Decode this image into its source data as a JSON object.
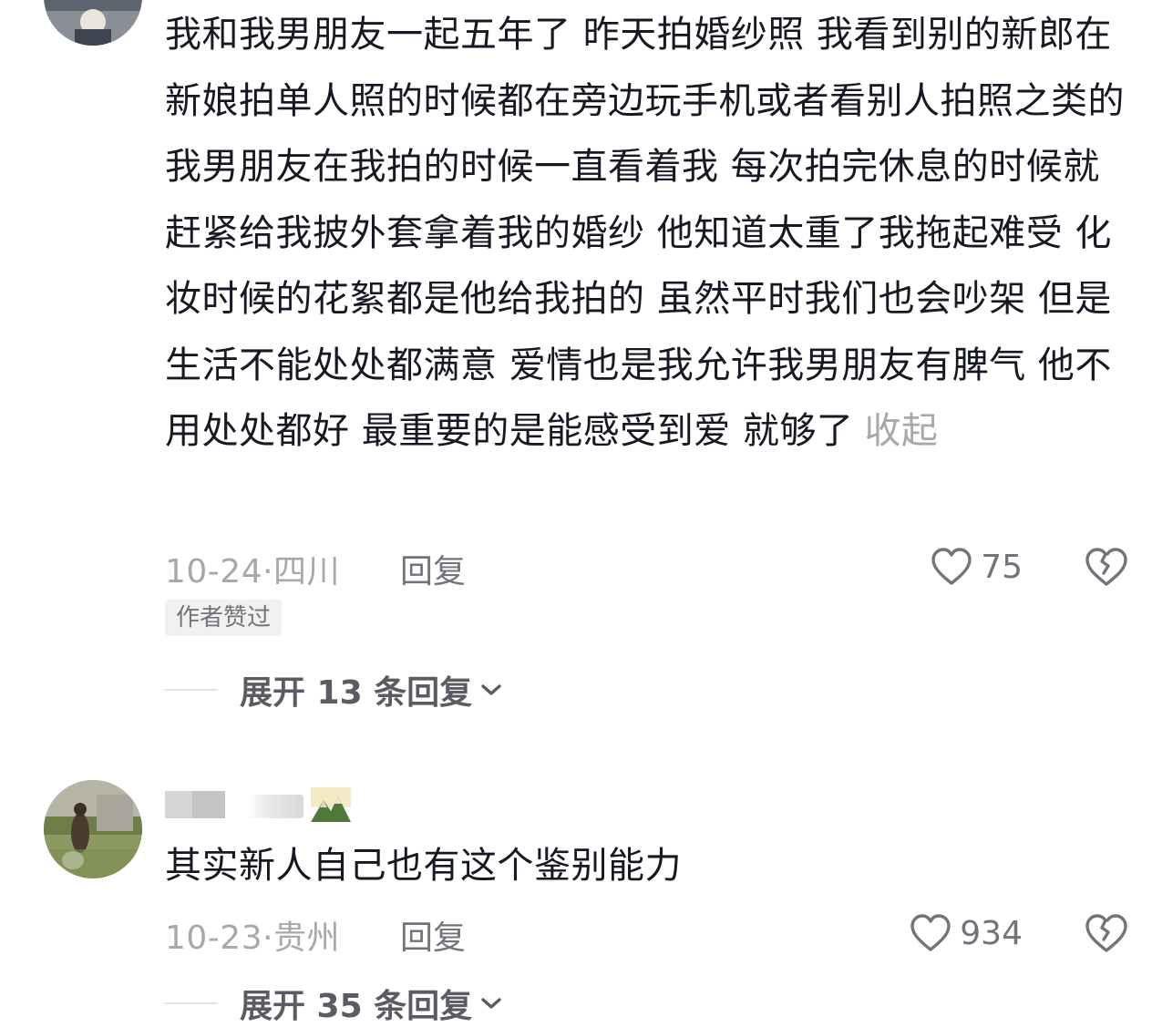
{
  "comments": [
    {
      "text": "我和我男朋友一起五年了 昨天拍婚纱照 我看到别的新郎在新娘拍单人照的时候都在旁边玩手机或者看别人拍照之类的 我男朋友在我拍的时候一直看着我 每次拍完休息的时候就赶紧给我披外套拿着我的婚纱 他知道太重了我拖起难受 化妆时候的花絮都是他给我拍的 虽然平时我们也会吵架 但是生活不能处处都满意 爱情也是我允许我男朋友有脾气 他不用处处都好 最重要的是能感受到爱 就够了",
      "collapse_label": "收起",
      "date_location": "10-24·四川",
      "reply_label": "回复",
      "like_count": "75",
      "badge": "作者赞过",
      "expand_replies": "展开 13 条回复",
      "icons": {
        "like": "heart-outline-icon",
        "dislike": "broken-heart-icon",
        "expand": "chevron-down-icon"
      }
    },
    {
      "text": "其实新人自己也有这个鉴别能力",
      "date_location": "10-23·贵州",
      "reply_label": "回复",
      "like_count": "934",
      "expand_replies": "展开 35 条回复",
      "icons": {
        "like": "heart-outline-icon",
        "dislike": "broken-heart-icon",
        "expand": "chevron-down-icon"
      }
    }
  ],
  "colors": {
    "primary_text": "#161823",
    "secondary_text": "#a7a8ad",
    "action_text": "#73747b",
    "expand_text": "#5b5c63",
    "badge_bg": "#f1f1f2"
  }
}
